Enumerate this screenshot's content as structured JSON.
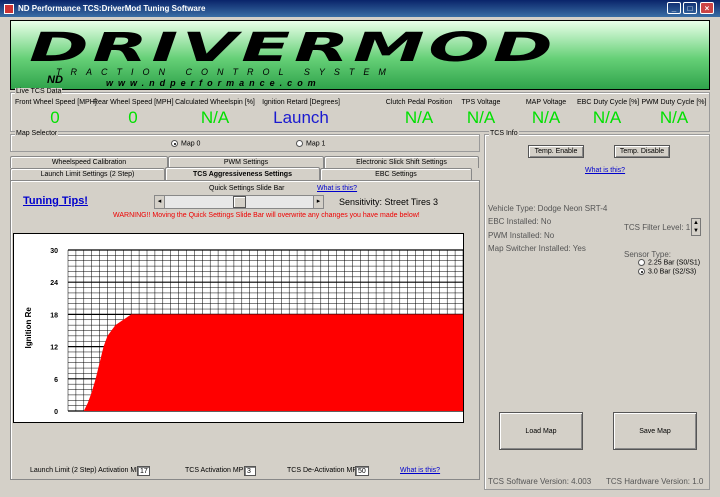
{
  "window": {
    "title": "ND Performance TCS:DriverMod Tuning Software",
    "minimize": "_",
    "maximize": "□",
    "close": "×"
  },
  "banner": {
    "logo_main": "DRIVERMOD",
    "logo_sub": "TRACTION CONTROL SYSTEM",
    "logo_url": "www.ndperformance.com",
    "logo_nd": "ND"
  },
  "live_data": {
    "title": "Live TCS Data",
    "fields": [
      {
        "label": "Front Wheel Speed [MPH]",
        "value": "0"
      },
      {
        "label": "Rear Wheel Speed [MPH]",
        "value": "0"
      },
      {
        "label": "Calculated Wheelspin [%]",
        "value": "N/A"
      },
      {
        "label": "Ignition Retard [Degrees]",
        "value": "Launch"
      },
      {
        "label": "Clutch Pedal Position",
        "value": "N/A"
      },
      {
        "label": "TPS Voltage",
        "value": "N/A"
      },
      {
        "label": "MAP Voltage",
        "value": "N/A"
      },
      {
        "label": "EBC Duty Cycle [%]",
        "value": "N/A"
      },
      {
        "label": "PWM Duty Cycle [%]",
        "value": "N/A"
      }
    ]
  },
  "map_selector": {
    "title": "Map Selector",
    "options": [
      "Map 0",
      "Map 1"
    ],
    "selected": "Map 0"
  },
  "tabs": {
    "row1": [
      "Wheelspeed Calibration",
      "PWM Settings",
      "Electronic Slick Shift Settings"
    ],
    "row2": [
      "Launch Limit Settings (2 Step)",
      "TCS Aggressiveness Settings",
      "EBC Settings"
    ],
    "active": "TCS Aggressiveness Settings"
  },
  "tcs_panel": {
    "tuning_tips": "Tuning Tips!",
    "slider_label": "Quick Settings Slide Bar",
    "what_is_this": "What is this?",
    "sensitivity": "Sensitivity: Street Tires 3",
    "warning": "WARNING!!  Moving the Quick Settings Slide Bar will overwrite any changes you have made below!",
    "slider_position": 0.5
  },
  "chart_data": {
    "type": "area",
    "ylabel": "Ignition Re",
    "xlabel": "",
    "ylim": [
      0,
      30
    ],
    "yticks": [
      "0",
      "6",
      "12",
      "18",
      "24",
      "30"
    ],
    "x": [
      0,
      1,
      2,
      3,
      4,
      5,
      6,
      7,
      8,
      9,
      10,
      12,
      14,
      16,
      20,
      30,
      40,
      50,
      60,
      70,
      80,
      90,
      100
    ],
    "values": [
      0,
      0,
      0,
      0,
      0,
      1.5,
      3.5,
      6,
      9,
      12,
      14,
      16,
      17,
      18,
      18,
      18,
      18,
      18,
      18,
      18,
      18,
      18,
      18
    ],
    "xlim": [
      0,
      100
    ],
    "fill_color": "#ff0000",
    "grid": true
  },
  "bottom_fields": {
    "launch_label": "Launch Limit (2 Step) Activation MPH:",
    "launch_value": "17",
    "activation_label": "TCS Activation MPH:",
    "activation_value": "3",
    "deactivation_label": "TCS De-Activation MPH:",
    "deactivation_value": "50",
    "what_is_this": "What is this?"
  },
  "tcs_info": {
    "title": "TCS Info",
    "temp_enable": "Temp. Enable",
    "temp_disable": "Temp. Disable",
    "what_is_this": "What is this?",
    "vehicle_type": "Vehicle Type: Dodge Neon SRT-4",
    "ebc_installed": "EBC Installed: No",
    "pwm_installed": "PWM Installed: No",
    "map_switcher": "Map Switcher Installed: Yes",
    "filter_level": "TCS Filter Level: 1",
    "sensor_type_label": "Sensor Type:",
    "sensor_options": [
      "2.25 Bar (S0/S1)",
      "3.0 Bar (S2/S3)"
    ],
    "sensor_selected": "3.0 Bar (S2/S3)",
    "load_map": "Load Map",
    "save_map": "Save Map",
    "software_version": "TCS Software Version: 4.003",
    "hardware_version": "TCS Hardware Version: 1.0"
  }
}
